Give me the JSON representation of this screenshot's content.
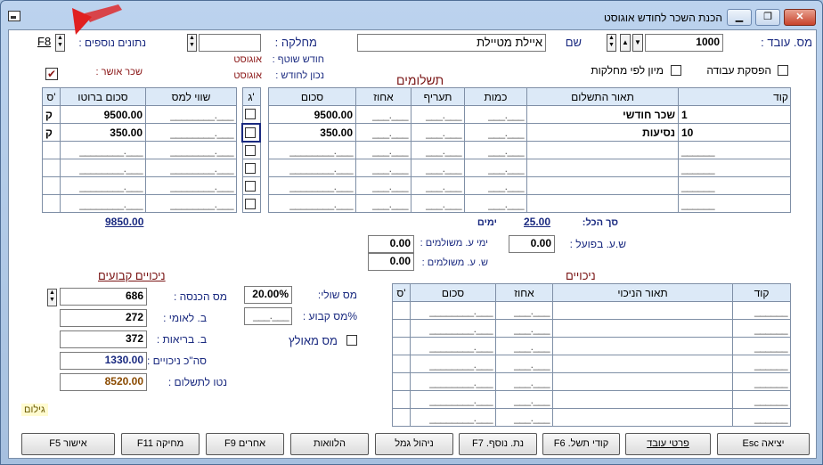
{
  "window": {
    "title": "הכנת השכר לחודש אוגוסט",
    "minimize_label": "▁",
    "maximize_label": "❐",
    "close_label": "✕"
  },
  "header": {
    "employee_no_label": "מס. עובד :",
    "employee_no_value": "1000",
    "name_label": "שם",
    "name_value": "איילת מטיילת",
    "department_label": "מחלקה :",
    "department_value": "",
    "extra_data_label": "נתונים נוספים :",
    "extra_data_value": "F8",
    "work_stop_label": "הפסקת עבודה",
    "sort_by_dept_label": "מיון לפי מחלקות",
    "current_month_label": "חודש שוטף :",
    "current_month_value": "אוגוסט",
    "correct_for_month_label": "נכון לחודש :",
    "correct_for_month_value": "אוגוסט",
    "approved_pay_label": "שכר אושר :",
    "approved_pay_check": "✔"
  },
  "payments": {
    "title": "תשלומים",
    "columns": [
      "קוד",
      "תאור התשלום",
      "כמות",
      "תעריף",
      "אחוז",
      "סכום",
      "ג'",
      "שווי למס",
      "סכום ברוטו",
      "ס'"
    ],
    "rows": [
      {
        "code": "1",
        "desc": "שכר חודשי",
        "qty": "___.___",
        "rate": "___.___",
        "pct": "___.___",
        "amount": "9500.00",
        "tax_value": "________.___",
        "gross": "9500.00",
        "s": "ק"
      },
      {
        "code": "10",
        "desc": "נסיעות",
        "qty": "___.___",
        "rate": "___.___",
        "pct": "___.___",
        "amount": "350.00",
        "tax_value": "________.___",
        "gross": "350.00",
        "s": "ק"
      },
      {
        "code": "______",
        "desc": "",
        "qty": "___.___",
        "rate": "___.___",
        "pct": "___.___",
        "amount": "________.___",
        "tax_value": "________.___",
        "gross": "________.___",
        "s": ""
      },
      {
        "code": "______",
        "desc": "",
        "qty": "___.___",
        "rate": "___.___",
        "pct": "___.___",
        "amount": "________.___",
        "tax_value": "________.___",
        "gross": "________.___",
        "s": ""
      },
      {
        "code": "______",
        "desc": "",
        "qty": "___.___",
        "rate": "___.___",
        "pct": "___.___",
        "amount": "________.___",
        "tax_value": "________.___",
        "gross": "________.___",
        "s": ""
      },
      {
        "code": "______",
        "desc": "",
        "qty": "___.___",
        "rate": "___.___",
        "pct": "___.___",
        "amount": "________.___",
        "tax_value": "________.___",
        "gross": "________.___",
        "s": ""
      }
    ],
    "total_label": "סך הכל:",
    "total_days_value": "25.00",
    "days_label": "ימים",
    "total_gross": "9850.00"
  },
  "hours": {
    "actual_hours_label": "ש.ע. בפועל :",
    "actual_hours_value": "0.00",
    "paid_days_label": "ימי ע. משולמים :",
    "paid_days_value": "0.00",
    "paid_hours_label": "ש. ע. משולמים :",
    "paid_hours_value": "0.00"
  },
  "fixed_deductions": {
    "title": "ניכויים קבועים",
    "income_tax_label": "מס הכנסה :",
    "income_tax_value": "686",
    "national_ins_label": "ב. לאומי :",
    "national_ins_value": "272",
    "health_ins_label": "ב. בריאות :",
    "health_ins_value": "372",
    "total_deductions_label": "סה\"כ ניכויים :",
    "total_deductions_value": "1330.00",
    "net_label": "נטו לתשלום :",
    "net_value": "8520.00",
    "marginal_tax_label": "מס שולי:",
    "marginal_tax_value": "20.00%",
    "fixed_tax_label": "%מס קבוע :",
    "fixed_tax_value": "___.___",
    "forced_tax_label": "מס מאולץ"
  },
  "deductions": {
    "title": "ניכויים",
    "columns": [
      "קוד",
      "תאור הניכוי",
      "אחוז",
      "סכום",
      "ס'"
    ],
    "rows": [
      {
        "code": "______",
        "desc": "",
        "pct": "___.___",
        "amount": "________.___",
        "s": ""
      },
      {
        "code": "______",
        "desc": "",
        "pct": "___.___",
        "amount": "________.___",
        "s": ""
      },
      {
        "code": "______",
        "desc": "",
        "pct": "___.___",
        "amount": "________.___",
        "s": ""
      },
      {
        "code": "______",
        "desc": "",
        "pct": "___.___",
        "amount": "________.___",
        "s": ""
      },
      {
        "code": "______",
        "desc": "",
        "pct": "___.___",
        "amount": "________.___",
        "s": ""
      },
      {
        "code": "______",
        "desc": "",
        "pct": "___.___",
        "amount": "________.___",
        "s": ""
      },
      {
        "code": "______",
        "desc": "",
        "pct": "___.___",
        "amount": "________.___",
        "s": ""
      }
    ]
  },
  "gilum_label": "גילום",
  "buttons": {
    "exit": "יציאה Esc",
    "employee_details": "פרטי עובד",
    "payment_codes": "קודי תשל. F6",
    "extra_data": "נת. נוסף. F7",
    "provident_mgmt": "ניהול גמל",
    "loans": "הלוואות",
    "others": "אחרים F9",
    "delete": "מחיקה F11",
    "approve": "אישור F5"
  },
  "colors": {
    "accent_navy": "#1a2a80",
    "section_title": "#7a1515",
    "net_value": "#8a4a00",
    "arrow": "#e02020"
  }
}
